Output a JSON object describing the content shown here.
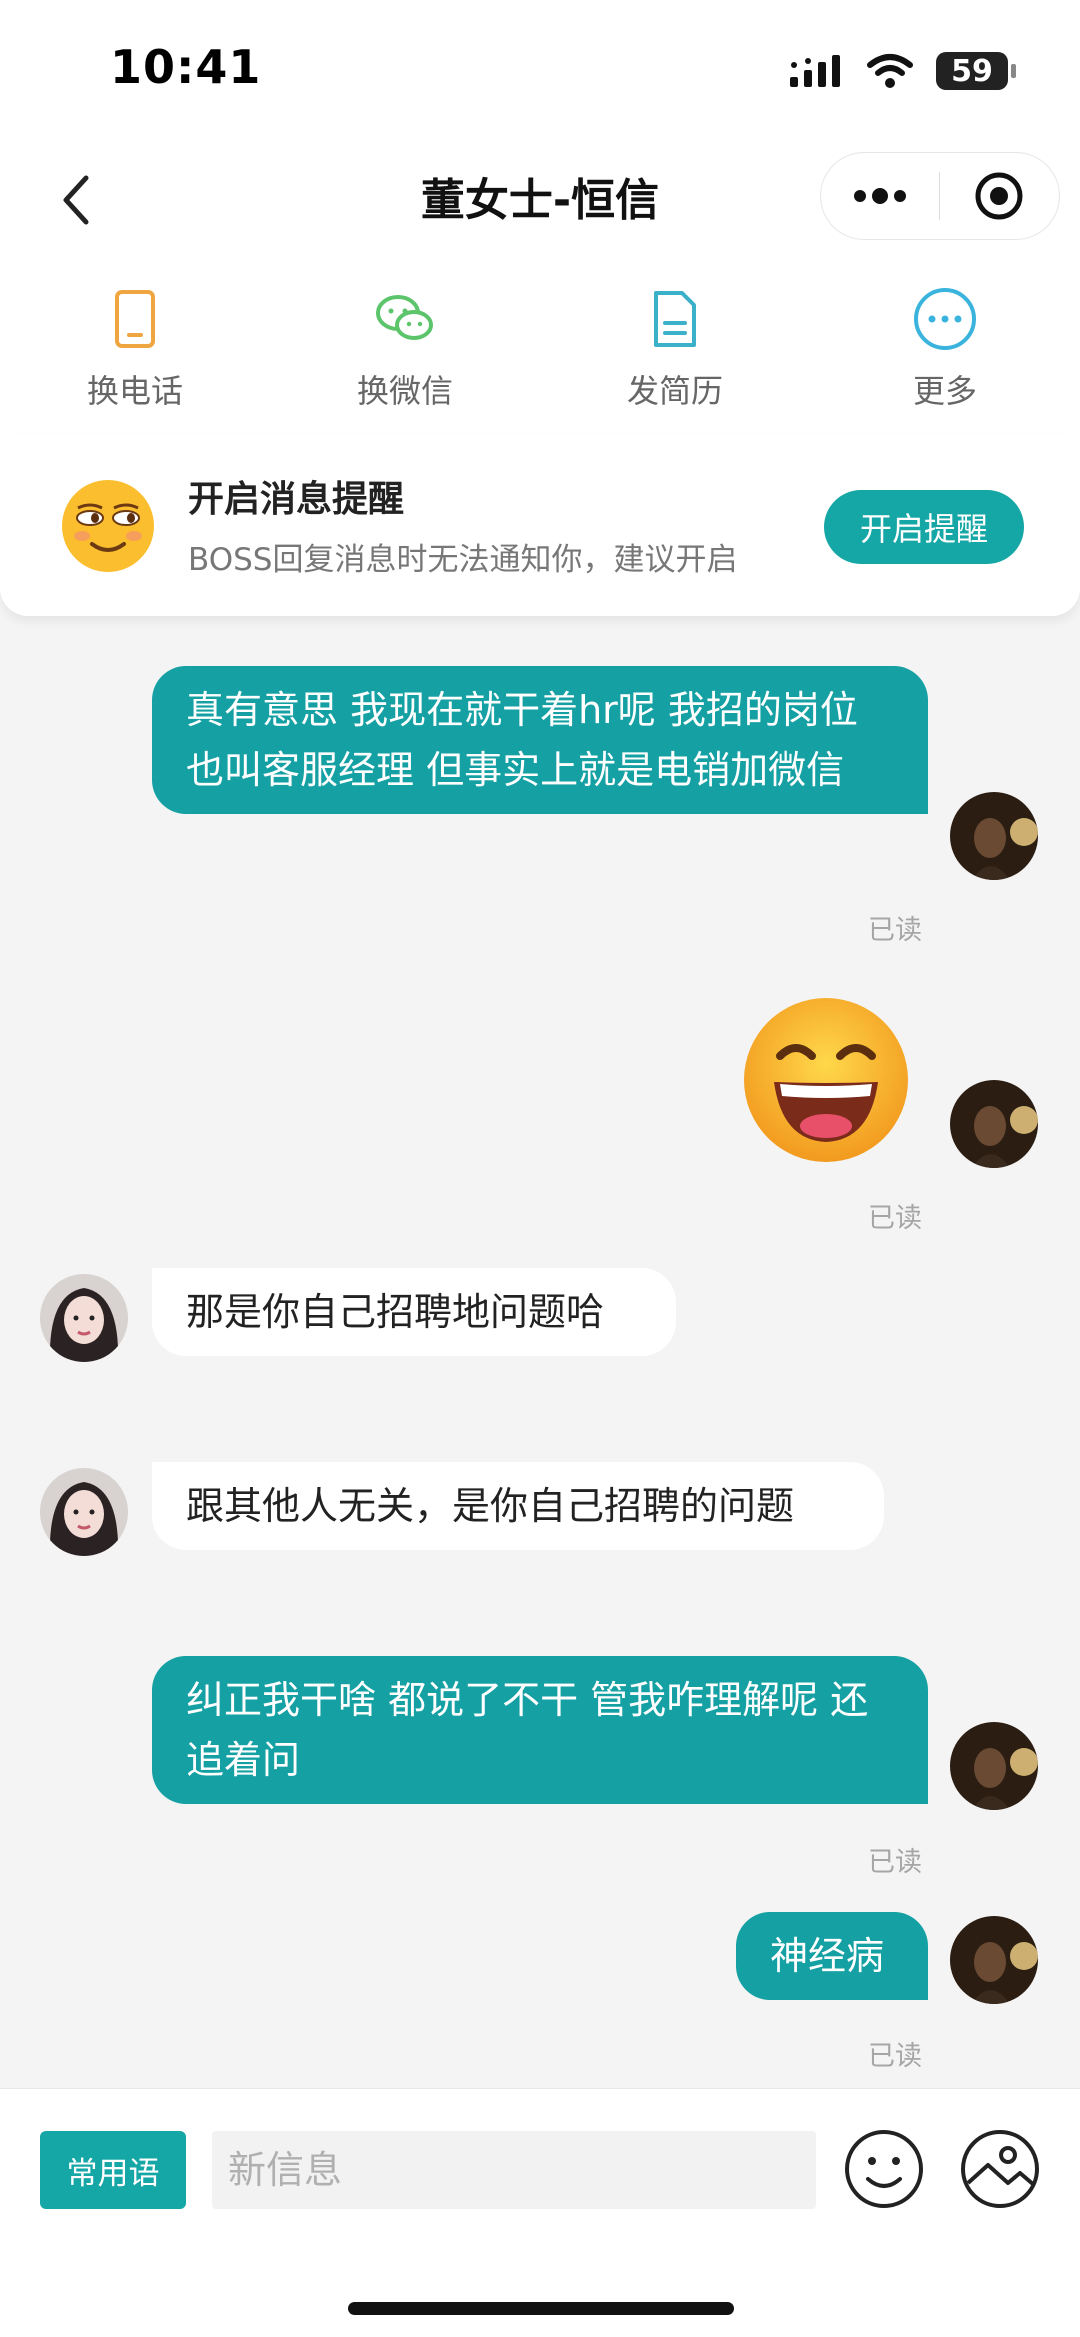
{
  "status": {
    "time": "10:41",
    "battery": "59"
  },
  "nav": {
    "title": "董女士-恒信"
  },
  "actions": [
    {
      "label": "换电话",
      "icon": "phone-icon"
    },
    {
      "label": "换微信",
      "icon": "wechat-icon"
    },
    {
      "label": "发简历",
      "icon": "resume-icon"
    },
    {
      "label": "更多",
      "icon": "more-icon"
    }
  ],
  "notify": {
    "title": "开启消息提醒",
    "subtitle": "BOSS回复消息时无法通知你，建议开启",
    "button": "开启提醒"
  },
  "messages": [
    {
      "side": "out",
      "text": "真有意思 我现在就干着hr呢 我招的岗位也叫客服经理 但事实上就是电销加微信",
      "read": "已读"
    },
    {
      "side": "out",
      "type": "emoji",
      "icon": "laughing-emoji-icon",
      "read": "已读"
    },
    {
      "side": "in",
      "text": "那是你自己招聘地问题哈"
    },
    {
      "side": "in",
      "text": "跟其他人无关，是你自己招聘的问题"
    },
    {
      "side": "out",
      "text": "纠正我干啥 都说了不干 管我咋理解呢 还追着问",
      "read": "已读"
    },
    {
      "side": "out",
      "text": "神经病",
      "read": "已读"
    }
  ],
  "input": {
    "phrases_button": "常用语",
    "placeholder": "新信息"
  },
  "colors": {
    "accent": "#15A6A6",
    "bubble_out": "#15A0A3",
    "background": "#F4F4F4"
  }
}
